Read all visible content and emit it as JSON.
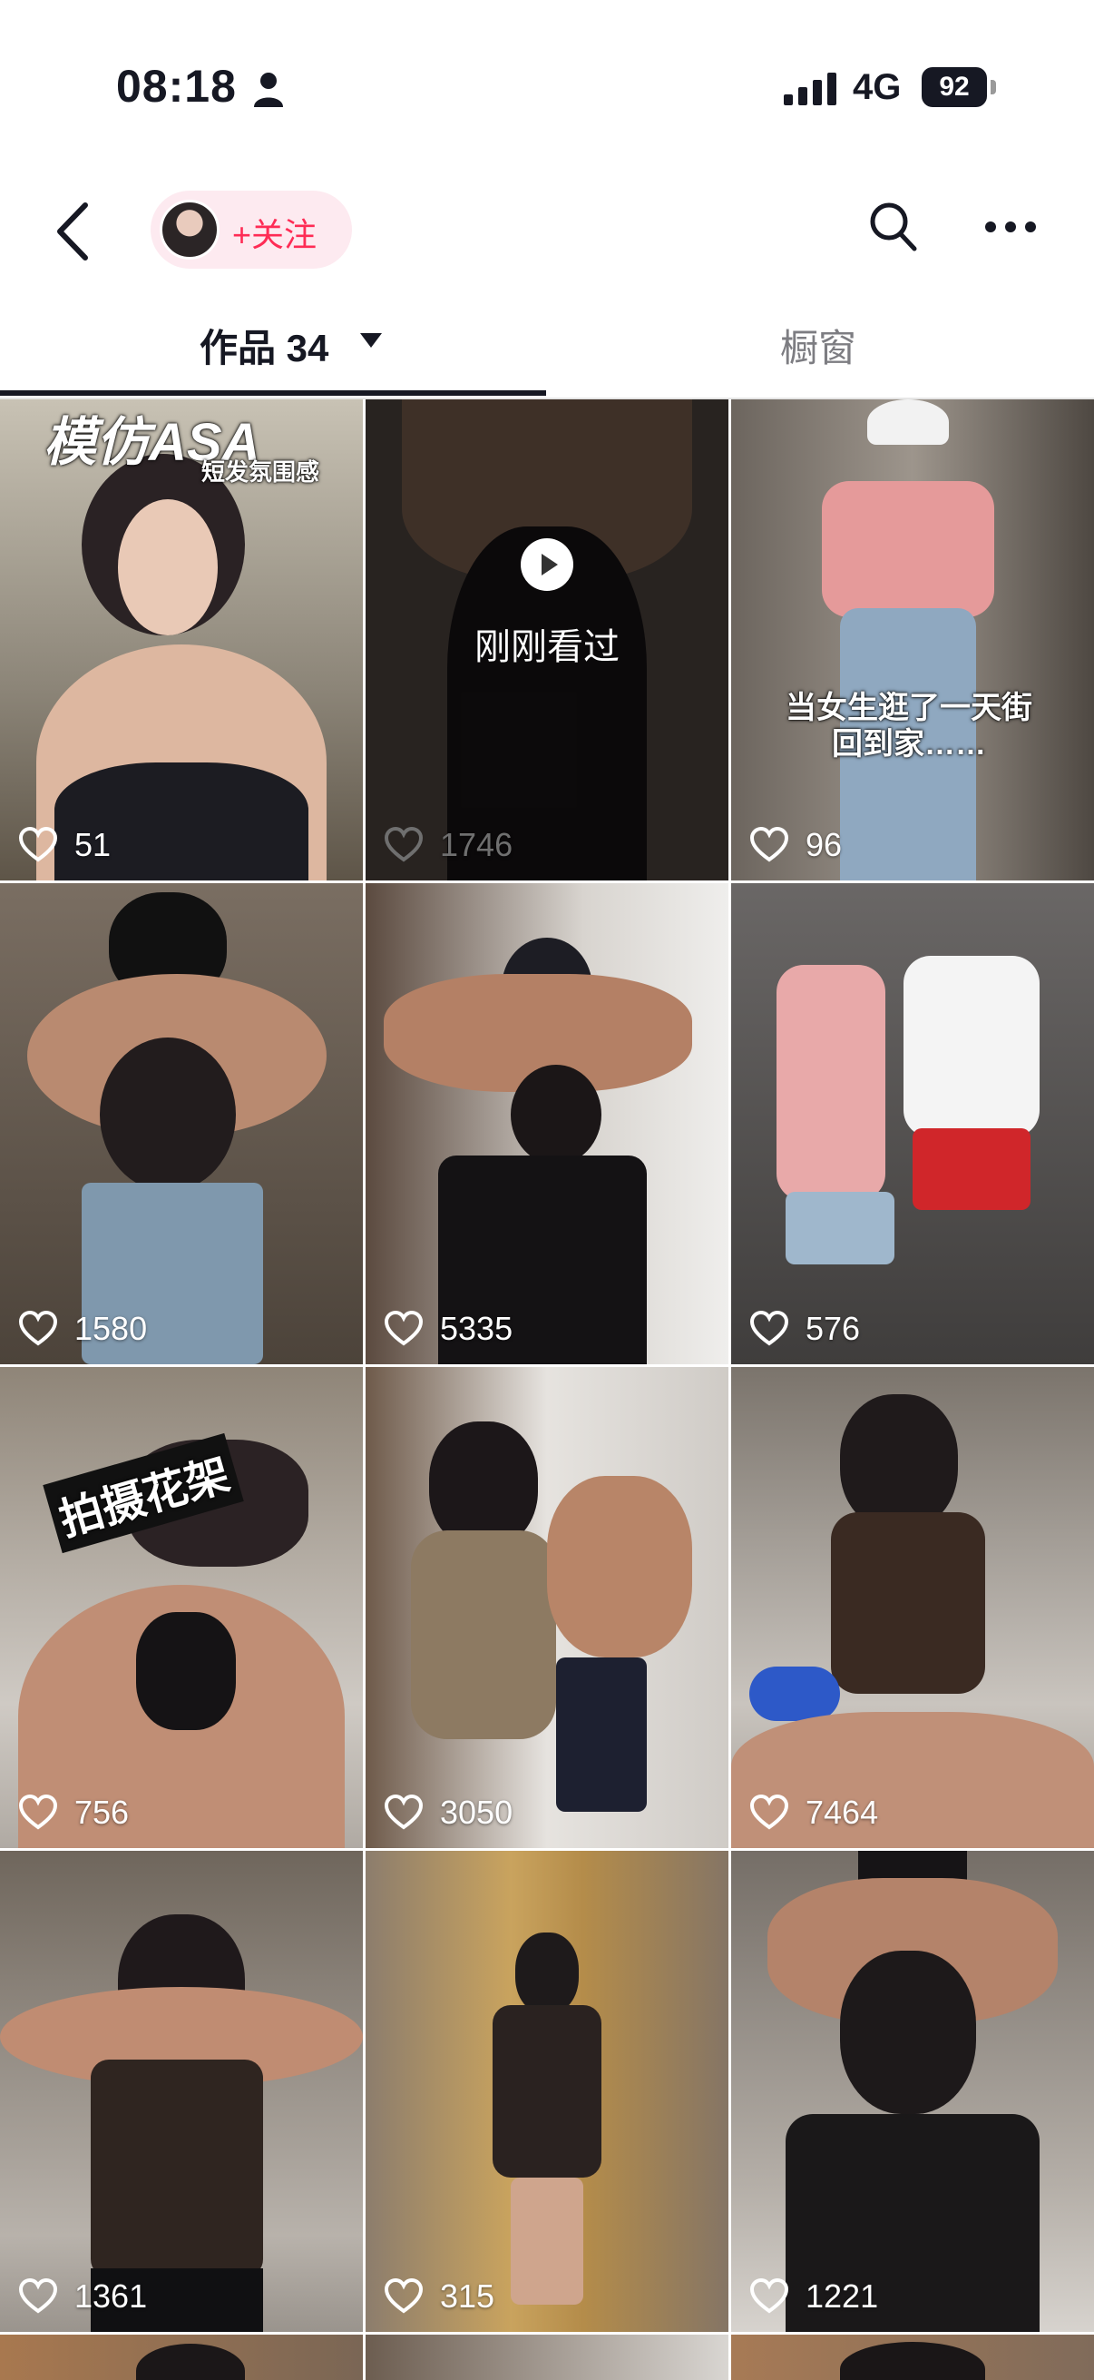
{
  "status_bar": {
    "time": "08:18",
    "network": "4G",
    "battery": "92"
  },
  "header": {
    "follow_label": "+关注"
  },
  "tabs": {
    "works_label": "作品 34",
    "window_label": "橱窗"
  },
  "grid": {
    "tiles": [
      {
        "likes": "51",
        "caption_title": "模仿ASA",
        "caption_sub": "短发氛围感"
      },
      {
        "likes": "1746",
        "overlay_label": "刚刚看过"
      },
      {
        "likes": "96",
        "caption": "当女生逛了一天街\n回到家……"
      },
      {
        "likes": "1580"
      },
      {
        "likes": "5335"
      },
      {
        "likes": "576"
      },
      {
        "likes": "756",
        "caption": "拍摄花架"
      },
      {
        "likes": "3050"
      },
      {
        "likes": "7464"
      },
      {
        "likes": "1361"
      },
      {
        "likes": "315"
      },
      {
        "likes": "1221"
      }
    ]
  },
  "colors": {
    "accent": "#fe2c55",
    "follow_bg": "#fdeaf0",
    "text": "#161823",
    "muted": "#7d7d82"
  },
  "icons": [
    "person-icon",
    "signal-icon",
    "battery-icon",
    "back-icon",
    "search-icon",
    "more-icon",
    "caret-icon",
    "heart-icon",
    "play-icon"
  ]
}
